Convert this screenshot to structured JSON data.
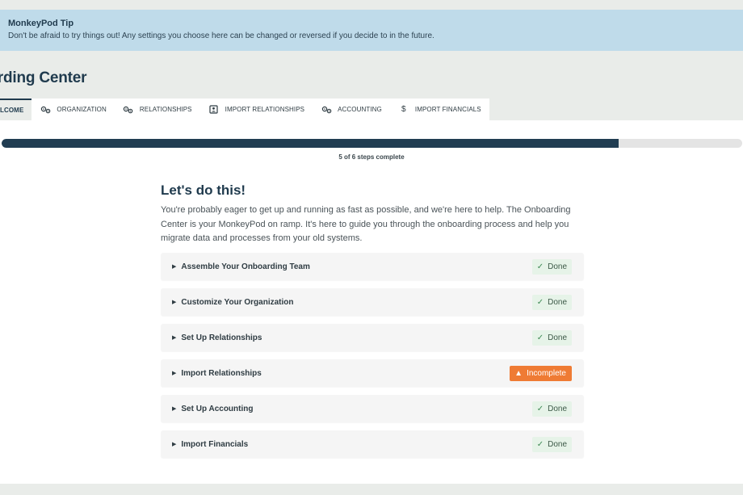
{
  "tip": {
    "title": "MonkeyPod Tip",
    "text": "Don't be afraid to try things out! Any settings you choose here can be changed or reversed if you decide to in the future."
  },
  "page_title": "oarding Center",
  "tabs": [
    {
      "label": "LCOME",
      "icon": "",
      "active": true
    },
    {
      "label": "ORGANIZATION",
      "icon": "gears-icon"
    },
    {
      "label": "RELATIONSHIPS",
      "icon": "gears-icon"
    },
    {
      "label": "IMPORT RELATIONSHIPS",
      "icon": "contact-card-icon"
    },
    {
      "label": "ACCOUNTING",
      "icon": "gears-icon"
    },
    {
      "label": "IMPORT FINANCIALS",
      "icon": "dollar-icon"
    }
  ],
  "progress": {
    "completed": 5,
    "total": 6,
    "label": "5 of 6 steps complete"
  },
  "intro": {
    "heading": "Let's do this!",
    "body": "You're probably eager to get up and running as fast as possible, and we're here to help. The Onboarding Center is your MonkeyPod on ramp. It's here to guide you through the onboarding process and help you migrate data and processes from your old systems."
  },
  "steps": [
    {
      "label": "Assemble Your Onboarding Team",
      "status": "Done"
    },
    {
      "label": "Customize Your Organization",
      "status": "Done"
    },
    {
      "label": "Set Up Relationships",
      "status": "Done"
    },
    {
      "label": "Import Relationships",
      "status": "Incomplete"
    },
    {
      "label": "Set Up Accounting",
      "status": "Done"
    },
    {
      "label": "Import Financials",
      "status": "Done"
    }
  ],
  "colors": {
    "brand_dark": "#1f3a4d",
    "tip_background": "#bfdbea",
    "done_badge": "#e6f3e8",
    "incomplete_badge": "#ef7b34"
  }
}
